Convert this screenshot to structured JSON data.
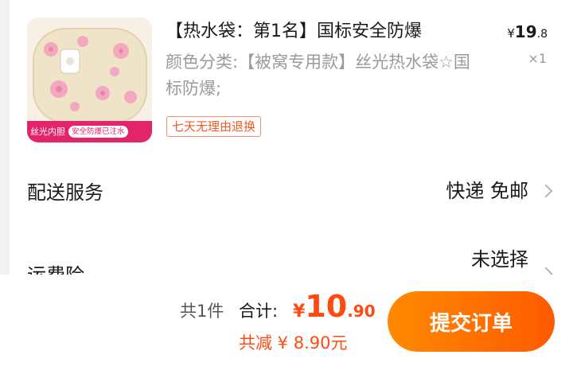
{
  "product": {
    "title": "【热水袋：第1名】国标安全防爆",
    "price_currency": "¥",
    "price_int": "19",
    "price_dec": ".8",
    "quantity": "×1",
    "sku": "颜色分类:【被窝专用款】丝光热水袋☆国标防爆;",
    "return_policy": "七天无理由退换",
    "thumb_badge_main": "丝光内胆",
    "thumb_badge_sub": "安全防爆已注水"
  },
  "delivery": {
    "label": "配送服务",
    "value": "快递 免邮"
  },
  "insurance": {
    "label": "运费险",
    "value": "未选择"
  },
  "checkout": {
    "count": "共1件",
    "total_label": "合计:",
    "total_currency": "¥",
    "total_int": "10",
    "total_dec": ".90",
    "discount": "共减 ¥ 8.90元",
    "submit_label": "提交订单"
  },
  "colors": {
    "accent": "#ff4b12",
    "button_start": "#ff8a00",
    "button_end": "#ff5a00",
    "thumb_badge": "#e4246a"
  }
}
